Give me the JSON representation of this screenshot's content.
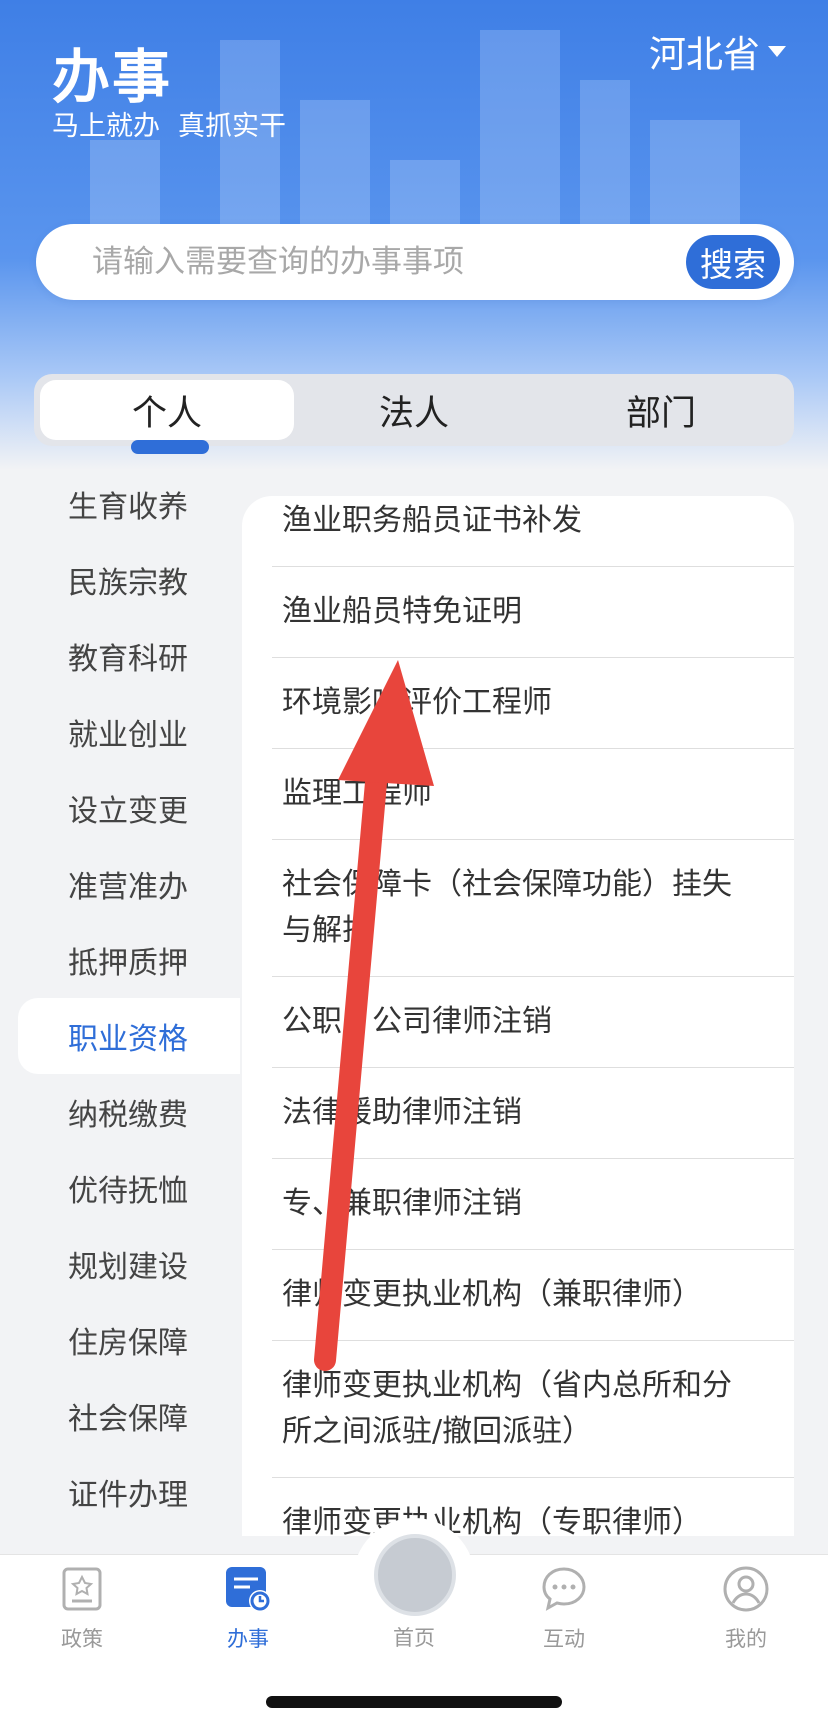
{
  "header": {
    "title": "办事",
    "slogan": [
      "马上就办",
      "真抓实干"
    ],
    "province": "河北省"
  },
  "search": {
    "placeholder": "请输入需要查询的办事事项",
    "button_label": "搜索"
  },
  "tabs": [
    {
      "label": "个人",
      "active": true
    },
    {
      "label": "法人",
      "active": false
    },
    {
      "label": "部门",
      "active": false
    }
  ],
  "sidebar": {
    "items": [
      "生育收养",
      "民族宗教",
      "教育科研",
      "就业创业",
      "设立变更",
      "准营准办",
      "抵押质押",
      "职业资格",
      "纳税缴费",
      "优待抚恤",
      "规划建设",
      "住房保障",
      "社会保障",
      "证件办理"
    ],
    "active_index": 7
  },
  "list": {
    "items": [
      "渔业职务船员证书补发",
      "渔业船员特免证明",
      "环境影响评价工程师",
      "监理工程师",
      "社会保障卡（社会保障功能）挂失与解挂",
      "公职、公司律师注销",
      "法律援助律师注销",
      "专、兼职律师注销",
      "律师变更执业机构（兼职律师）",
      "律师变更执业机构（省内总所和分所之间派驻/撤回派驻）",
      "律师变更执业机构（专职律师）"
    ]
  },
  "tabbar": {
    "items": [
      {
        "label": "政策",
        "icon": "policy-icon",
        "active": false
      },
      {
        "label": "办事",
        "icon": "affairs-icon",
        "active": true
      },
      {
        "label": "首页",
        "icon": "emblem-icon",
        "active": false
      },
      {
        "label": "互动",
        "icon": "chat-icon",
        "active": false
      },
      {
        "label": "我的",
        "icon": "user-icon",
        "active": false
      }
    ]
  },
  "colors": {
    "accent": "#2f6ed8",
    "header_blue": "#3f7fe6",
    "annotation_arrow": "#e8453c"
  }
}
